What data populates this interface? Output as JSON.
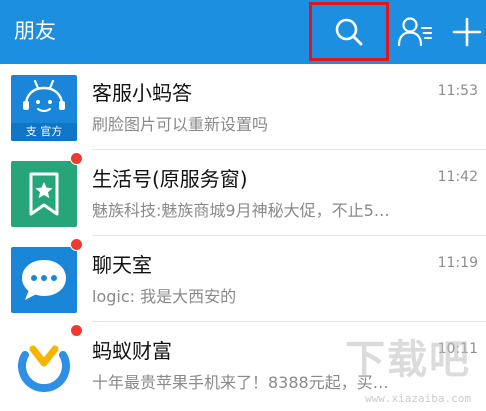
{
  "header": {
    "title": "朋友",
    "icons": [
      "search-icon",
      "contacts-icon",
      "add-icon"
    ],
    "background": "#1d8fe0",
    "highlight_color": "#e3141c"
  },
  "chats": [
    {
      "name": "客服小蚂答",
      "message": "刷脸图片可以重新设置吗",
      "time": "11:53",
      "unread": false,
      "avatar_icon": "customer-service-robot-icon",
      "avatar_color": "#1a86d9",
      "official_tag": "官方"
    },
    {
      "name": "生活号(原服务窗)",
      "message": "魅族科技:魅族商城9月神秘大促，不止5…",
      "time": "11:42",
      "unread": true,
      "avatar_icon": "star-bookmark-icon",
      "avatar_color": "#26a57a"
    },
    {
      "name": "聊天室",
      "message": "logic: 我是大西安的",
      "time": "11:19",
      "unread": true,
      "avatar_icon": "chat-bubble-icon",
      "avatar_color": "#1a86d9"
    },
    {
      "name": "蚂蚁财富",
      "message": "十年最贵苹果手机来了！8388元起，买…",
      "time": "10:11",
      "unread": true,
      "avatar_icon": "ant-fortune-logo-icon",
      "avatar_color": "#ffffff"
    }
  ],
  "badge_color": "#f0392f",
  "watermark": {
    "text": "下载吧",
    "url": "www.xiazaiba.com"
  }
}
